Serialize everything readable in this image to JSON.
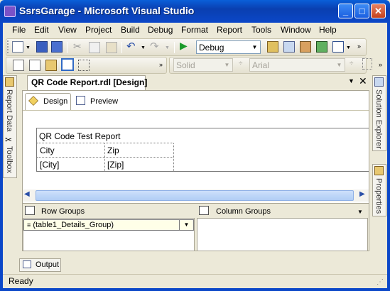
{
  "window": {
    "title": "SsrsGarage - Microsoft Visual Studio",
    "controls": {
      "minimize": "_",
      "maximize": "□",
      "close": "✕"
    }
  },
  "menu": [
    "File",
    "Edit",
    "View",
    "Project",
    "Build",
    "Debug",
    "Format",
    "Report",
    "Tools",
    "Window",
    "Help"
  ],
  "toolbar": {
    "config_combo": "Debug",
    "border_style_combo": "Solid",
    "font_combo": "Arial",
    "icons": [
      "new-project-icon",
      "save-icon",
      "save-all-icon",
      "cut-icon",
      "copy-icon",
      "paste-icon",
      "undo-icon",
      "redo-icon",
      "start-debug-icon",
      "find-in-files-icon",
      "properties-icon",
      "toolbox-tools-icon",
      "import-icon",
      "command-window-icon",
      "overflow-icon"
    ]
  },
  "left_tabs": [
    "Report Data",
    "Toolbox"
  ],
  "right_tabs": [
    "Solution Explorer",
    "Properties"
  ],
  "document": {
    "tab_title": "QR Code Report.rdl [Design]",
    "subtabs": {
      "design": "Design",
      "preview": "Preview"
    },
    "report": {
      "title": "QR Code Test Report",
      "headers": [
        "City",
        "Zip"
      ],
      "row": [
        "[City]",
        "[Zip]"
      ]
    },
    "row_groups_label": "Row Groups",
    "column_groups_label": "Column Groups",
    "row_group_item": "(table1_Details_Group)"
  },
  "output_tab": "Output",
  "status": "Ready",
  "colors": {
    "titlebar": "#0a46c8",
    "frame": "#0b47c8",
    "face": "#ece9d8",
    "accent": "#316ac5"
  }
}
